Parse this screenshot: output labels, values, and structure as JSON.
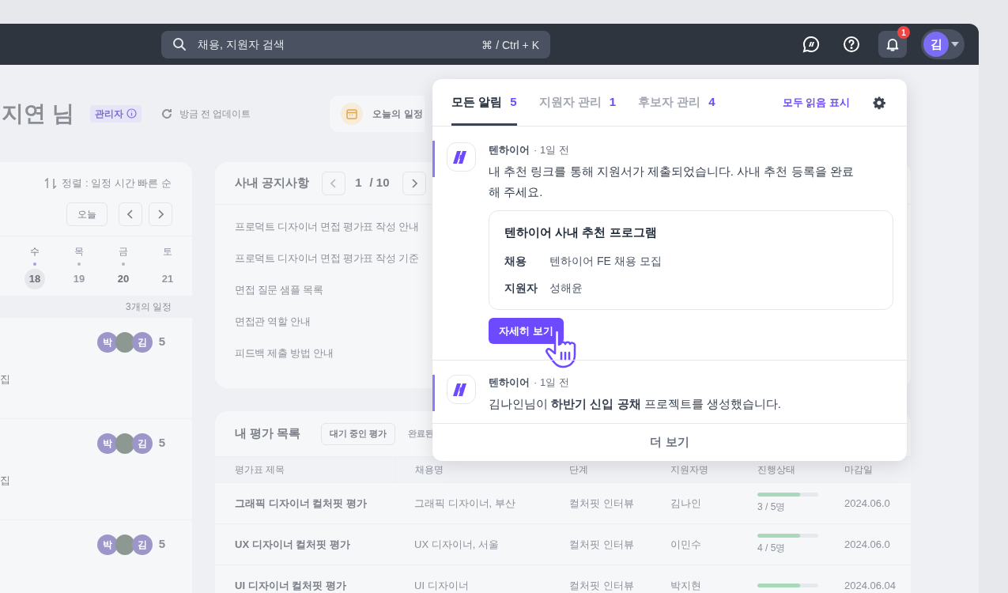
{
  "top_bar": {
    "search": {
      "placeholder": "채용, 지원자 검색",
      "shortcut": "⌘ / Ctrl + K"
    },
    "notification_count": "1",
    "avatar": "김"
  },
  "header": {
    "greeting": "지연 님",
    "role_badge": "관리자",
    "updated": "방금 전 업데이트",
    "today_card": "오늘의 일정"
  },
  "schedule": {
    "sort": "정렬 : 일정 시간 빠른 순",
    "today_button": "오늘",
    "days": [
      {
        "weekday": "수",
        "date": "18",
        "selected": true,
        "has_event": true,
        "dimmed": false
      },
      {
        "weekday": "목",
        "date": "19",
        "selected": false,
        "has_event": true,
        "dimmed": true
      },
      {
        "weekday": "금",
        "date": "20",
        "selected": false,
        "has_event": true,
        "dimmed": false
      },
      {
        "weekday": "토",
        "date": "21",
        "selected": false,
        "has_event": false,
        "dimmed": true
      }
    ],
    "count": "3개의 일정",
    "items": [
      {
        "title": "집",
        "avatars": [
          {
            "kind": "initial",
            "text": "박"
          },
          {
            "kind": "photo"
          },
          {
            "kind": "initial",
            "text": "김"
          }
        ],
        "count": "5"
      },
      {
        "title": "집",
        "avatars": [
          {
            "kind": "initial",
            "text": "박"
          },
          {
            "kind": "photo"
          },
          {
            "kind": "initial",
            "text": "김"
          }
        ],
        "count": "5"
      },
      {
        "avatars": [
          {
            "kind": "initial",
            "text": "박"
          },
          {
            "kind": "photo"
          },
          {
            "kind": "initial",
            "text": "김"
          }
        ],
        "count": "5"
      }
    ]
  },
  "notices": {
    "title": "사내 공지사항",
    "page": "1",
    "total": "/ 10",
    "items": [
      "프로덕트 디자이너 면접 평가표 작성 안내",
      "프로덕트 디자이너 면접 평가표 작성 기준",
      "면접 질문 샘플 목록",
      "면접관 역할 안내",
      "피드백 제출 방법 안내"
    ]
  },
  "evaluations": {
    "title": "내 평가 목록",
    "tabs": [
      {
        "label": "대기 중인 평가",
        "selected": true
      },
      {
        "label": "완료된",
        "selected": false
      }
    ],
    "columns": [
      "평가표 제목",
      "채용명",
      "단계",
      "지원자명",
      "진행상태",
      "마감일"
    ],
    "rows": [
      {
        "title": "그래픽 디자이너 컬처핏 평가",
        "job": "그래픽 디자이너, 부산",
        "stage": "컬처핏 인터뷰",
        "applicant": "김나인",
        "level": 0.7,
        "progress": "3 / 5명",
        "deadline": "2024.06.0"
      },
      {
        "title": "UX 디자이너 컬처핏 평가",
        "job": "UX 디자이너, 서울",
        "stage": "컬처핏 인터뷰",
        "applicant": "이민수",
        "level": 0.7,
        "progress": "4 / 5명",
        "deadline": "2024.06.0"
      },
      {
        "title": "UI 디자이너 컬처핏 평가",
        "job": "UI 디자이너",
        "stage": "컬처핏 인터뷰",
        "applicant": "박지현",
        "level": 0.7,
        "deadline": "2024.06.04"
      }
    ]
  },
  "notifications": {
    "tabs": [
      {
        "label": "모든 알림",
        "count": "5",
        "selected": true
      },
      {
        "label": "지원자 관리",
        "count": "1",
        "selected": false
      },
      {
        "label": "후보자 관리",
        "count": "4",
        "selected": false
      }
    ],
    "mark_all_read": "모두 읽음 표시",
    "items": [
      {
        "sender": "텐하이어",
        "time": "· 1일 전",
        "unread": true,
        "message": "내 추천 링크를 통해 지원서가 제출되었습니다. 사내 추천 등록을 완료해 주세요.",
        "card": {
          "title": "텐하이어 사내 추천 프로그램",
          "fields": [
            {
              "label": "채용",
              "value": "텐하이어 FE 채용 모집"
            },
            {
              "label": "지원자",
              "value": "성해윤"
            }
          ]
        },
        "action": "자세히 보기"
      },
      {
        "sender": "텐하이어",
        "time": "· 1일 전",
        "unread": true,
        "message": "김나인님이 **하반기 신입 공채** 프로젝트를 생성했습니다."
      }
    ],
    "more": "더 보기"
  }
}
